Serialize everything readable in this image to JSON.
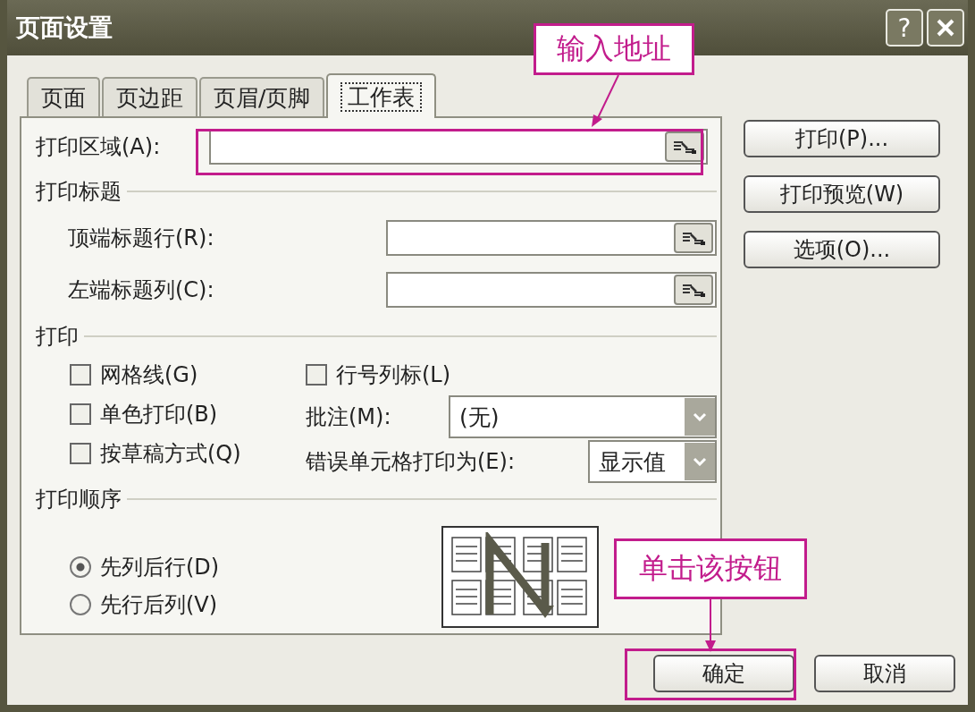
{
  "window": {
    "title": "页面设置",
    "help": "?"
  },
  "tabs": [
    {
      "label": "页面",
      "selected": false
    },
    {
      "label": "页边距",
      "selected": false
    },
    {
      "label": "页眉/页脚",
      "selected": false
    },
    {
      "label": "工作表",
      "selected": true
    }
  ],
  "print_area": {
    "label": "打印区域(A):"
  },
  "print_titles": {
    "heading": "打印标题",
    "fields": [
      {
        "label": "顶端标题行(R):"
      },
      {
        "label": "左端标题列(C):"
      }
    ]
  },
  "print": {
    "heading": "打印",
    "checkboxes": [
      {
        "label": "网格线(G)",
        "checked": false
      },
      {
        "label": "单色打印(B)",
        "checked": false
      },
      {
        "label": "按草稿方式(Q)",
        "checked": false
      },
      {
        "label": "行号列标(L)",
        "checked": false
      }
    ],
    "comments": {
      "label": "批注(M):",
      "value": "(无)"
    },
    "cell_errors": {
      "label": "错误单元格打印为(E):",
      "value": "显示值"
    }
  },
  "page_order": {
    "heading": "打印顺序",
    "radios": [
      {
        "label": "先列后行(D)",
        "selected": true
      },
      {
        "label": "先行后列(V)",
        "selected": false
      }
    ]
  },
  "side_buttons": [
    "打印(P)...",
    "打印预览(W)",
    "选项(O)..."
  ],
  "footer_buttons": [
    "确定",
    "取消"
  ],
  "annotations": [
    {
      "text": "输入地址"
    },
    {
      "text": "单击该按钮"
    }
  ]
}
